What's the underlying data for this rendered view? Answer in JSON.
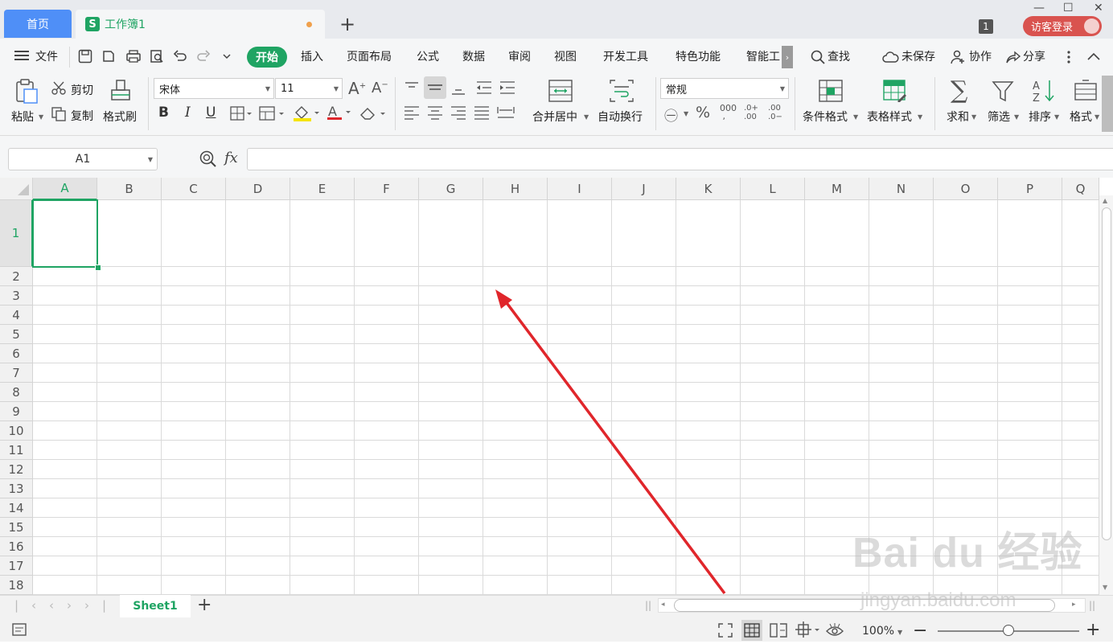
{
  "tabs": {
    "home": "首页",
    "doc": "工作簿1",
    "doc_logo": "S",
    "new_tab": "+"
  },
  "titlebar": {
    "badge": "1",
    "login": "访客登录",
    "min": "—",
    "max": "☐",
    "close": "✕"
  },
  "menu": {
    "file": "文件",
    "start": "开始",
    "items": [
      "插入",
      "页面布局",
      "公式",
      "数据",
      "审阅",
      "视图",
      "开发工具",
      "特色功能",
      "智能工"
    ],
    "find": "查找",
    "unsaved": "未保存",
    "collab": "协作",
    "share": "分享"
  },
  "ribbon": {
    "paste": "粘贴",
    "cut": "剪切",
    "copy": "复制",
    "format_painter": "格式刷",
    "font_name": "宋体",
    "font_size": "11",
    "bold": "B",
    "italic": "I",
    "underline": "U",
    "merge_center": "合并居中",
    "auto_wrap": "自动换行",
    "number_format": "常规",
    "cond_format": "条件格式",
    "table_style": "表格样式",
    "sum": "求和",
    "filter": "筛选",
    "sort": "排序",
    "format": "格式"
  },
  "formula_bar": {
    "cell_ref": "A1",
    "fx": "fx",
    "value": ""
  },
  "grid": {
    "columns": [
      "A",
      "B",
      "C",
      "D",
      "E",
      "F",
      "G",
      "H",
      "I",
      "J",
      "K",
      "L",
      "M",
      "N",
      "O",
      "P",
      "Q"
    ],
    "rows": [
      "1",
      "2",
      "3",
      "4",
      "5",
      "6",
      "7",
      "8",
      "9",
      "10",
      "11",
      "12",
      "13",
      "14",
      "15",
      "16",
      "17",
      "18"
    ],
    "selected": "A1"
  },
  "sheets": {
    "tabs": [
      "Sheet1"
    ],
    "add": "+"
  },
  "status": {
    "zoom": "100%",
    "zoom_minus": "−",
    "zoom_plus": "+",
    "zoom_level": 0.5
  },
  "watermark": {
    "brand": "Bai du 经验",
    "url": "jingyan.baidu.com"
  },
  "colors": {
    "accent": "#1fa463",
    "home_tab": "#4f8ff7",
    "login": "#d9534f",
    "arrow": "#e0262b"
  }
}
